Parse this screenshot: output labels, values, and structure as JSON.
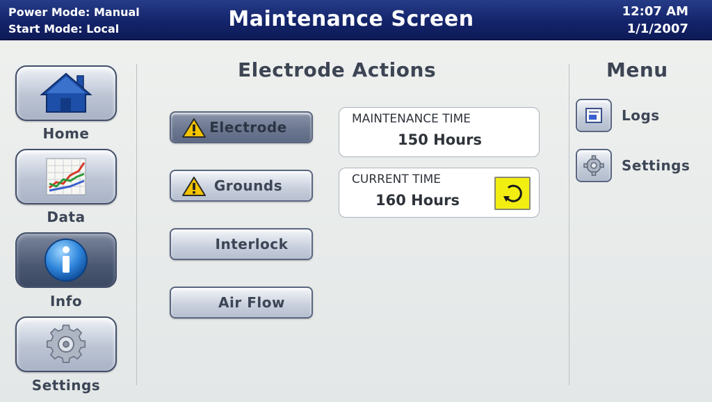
{
  "header": {
    "power_mode": "Power Mode: Manual",
    "start_mode": "Start Mode: Local",
    "title": "Maintenance Screen",
    "time": "12:07 AM",
    "date": "1/1/2007"
  },
  "nav": {
    "items": [
      {
        "label": "Home",
        "icon": "house-icon"
      },
      {
        "label": "Data",
        "icon": "chart-icon"
      },
      {
        "label": "Info",
        "icon": "info-icon",
        "active": true
      },
      {
        "label": "Settings",
        "icon": "gear-icon"
      }
    ]
  },
  "actions": {
    "title": "Electrode Actions",
    "buttons": [
      {
        "label": "Electrode",
        "warning": true,
        "active": true
      },
      {
        "label": "Grounds",
        "warning": true
      },
      {
        "label": "Interlock"
      },
      {
        "label": "Air Flow"
      }
    ]
  },
  "status": {
    "maintenance_time_label": "MAINTENANCE TIME",
    "maintenance_time_value": "150 Hours",
    "current_time_label": "CURRENT TIME",
    "current_time_value": "160 Hours",
    "reset_icon": "reset-icon"
  },
  "menu": {
    "title": "Menu",
    "items": [
      {
        "label": "Logs",
        "icon": "logs-icon"
      },
      {
        "label": "Settings",
        "icon": "gear-icon"
      }
    ]
  },
  "colors": {
    "header_bg": "#14246a",
    "accent_yellow": "#f2ee12",
    "warning_yellow": "#f4c400",
    "home_blue": "#1d4fa8"
  }
}
